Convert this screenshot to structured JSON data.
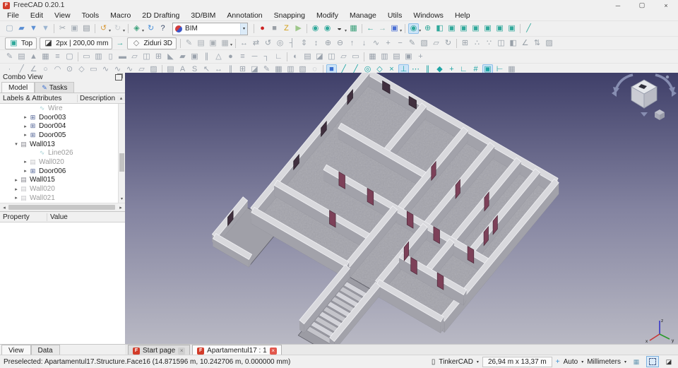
{
  "window": {
    "title": "FreeCAD 0.20.1",
    "logo_glyph": "F",
    "controls": [
      {
        "n": "minimize-icon",
        "g": "─"
      },
      {
        "n": "maximize-icon",
        "g": "▢"
      },
      {
        "n": "close-icon",
        "g": "×"
      }
    ]
  },
  "glyphs": {
    "caret_down": "▾",
    "scroll_up": "▴",
    "scroll_down": "▾",
    "scroll_left": "◂",
    "scroll_right": "▸",
    "expander_collapsed": "▸",
    "expander_expanded": "▾",
    "close": "×",
    "pencil": "✎"
  },
  "menubar": [
    "File",
    "Edit",
    "View",
    "Tools",
    "Macro",
    "2D Drafting",
    "3D/BIM",
    "Annotation",
    "Snapping",
    "Modify",
    "Manage",
    "Utils",
    "Windows",
    "Help"
  ],
  "workbench": {
    "value": "BIM"
  },
  "toolbars": {
    "row1a": [
      {
        "n": "file-new",
        "g": "▢",
        "c": "#9fb0c0"
      },
      {
        "n": "file-open",
        "g": "▰",
        "c": "#5b8fd4"
      },
      {
        "n": "file-save",
        "g": "▼",
        "c": "#5b8fd4"
      },
      {
        "n": "file-save-as",
        "g": "▼",
        "c": "#9ab4d0"
      },
      {
        "n": "cut",
        "g": "✂",
        "c": "#9aa2aa",
        "sep": true
      },
      {
        "n": "copy",
        "g": "▣",
        "c": "#aab2ba"
      },
      {
        "n": "paste",
        "g": "▤",
        "c": "#8a929a"
      },
      {
        "n": "undo",
        "g": "↺",
        "c": "#d79a3c",
        "caret": true,
        "sep": true
      },
      {
        "n": "redo",
        "g": "↻",
        "c": "#c9cdd1",
        "caret": true
      },
      {
        "n": "workbench-tools",
        "g": "◈",
        "c": "#3aa07a",
        "caret": true,
        "sep": true
      },
      {
        "n": "refresh",
        "g": "↻",
        "c": "#4a90d9"
      },
      {
        "n": "whats-this",
        "g": "?",
        "c": "#3a4a6a"
      }
    ],
    "row1b": [
      {
        "n": "macro-record",
        "g": "●",
        "c": "#cc2222",
        "sep": true
      },
      {
        "n": "macro-stop",
        "g": "■",
        "c": "#9aa0a6"
      },
      {
        "n": "macro-edit",
        "g": "Z",
        "c": "#d4a017"
      },
      {
        "n": "macro-execute",
        "g": "▶",
        "c": "#9ec78a"
      },
      {
        "n": "selection-view",
        "g": "◉",
        "c": "#2fa89a",
        "sep": true
      },
      {
        "n": "box-selection",
        "g": "◉",
        "c": "#2fa89a"
      },
      {
        "n": "draw-style",
        "g": "◒",
        "c": "#333333",
        "caret": true
      },
      {
        "n": "texture-mode",
        "g": "▦",
        "c": "#3aa07a"
      },
      {
        "n": "nav-back",
        "g": "←",
        "c": "#2fa89a",
        "sep": true
      },
      {
        "n": "nav-forward",
        "g": "→",
        "c": "#8fb8b2"
      },
      {
        "n": "linked-object-nav",
        "g": "▣",
        "c": "#4a6fd4",
        "caret": true
      },
      {
        "n": "zoom-tool",
        "g": "◉",
        "c": "#2fa89a",
        "caret": true,
        "hl": true,
        "sep": true
      },
      {
        "n": "view-fit-all",
        "g": "⊕",
        "c": "#2fa89a"
      },
      {
        "n": "view-axonometric",
        "g": "◧",
        "c": "#2fa89a"
      },
      {
        "n": "view-front",
        "g": "▣",
        "c": "#2fa89a"
      },
      {
        "n": "view-top",
        "g": "▣",
        "c": "#2fa89a"
      },
      {
        "n": "view-right",
        "g": "▣",
        "c": "#2fa89a"
      },
      {
        "n": "view-rear",
        "g": "▣",
        "c": "#2fa89a"
      },
      {
        "n": "view-bottom",
        "g": "▣",
        "c": "#2fa89a"
      },
      {
        "n": "view-left",
        "g": "▣",
        "c": "#2fa89a"
      },
      {
        "n": "bim-measure",
        "g": "╱",
        "c": "#2fa89a",
        "sep": true
      }
    ],
    "tray": {
      "top_label": "Top",
      "top_icon_glyph": "▣",
      "linewidth_label": "2px | 200,00 mm",
      "linewidth_icon_glyph": "◪",
      "arrow_glyph": "→",
      "layer_label": "Ziduri 3D",
      "layer_icon_glyph": "◇"
    },
    "row2": [
      {
        "n": "draft-apply-style",
        "g": "✎",
        "c": "#a8aeb4",
        "sep": true
      },
      {
        "n": "draft-layer",
        "g": "▤",
        "c": "#a8aeb4"
      },
      {
        "n": "draft-add-to-group",
        "g": "▣",
        "c": "#a8aeb4"
      },
      {
        "n": "draft-select-group",
        "g": "▦",
        "c": "#a8aeb4",
        "caret": true
      },
      {
        "n": "draft-move",
        "g": "↔",
        "c": "#98a0a8",
        "sep": true
      },
      {
        "n": "draft-copy",
        "g": "⇄",
        "c": "#98a0a8"
      },
      {
        "n": "draft-rotate",
        "g": "↺",
        "c": "#98a0a8"
      },
      {
        "n": "draft-offset",
        "g": "◎",
        "c": "#98a0a8"
      },
      {
        "n": "draft-trimex",
        "g": "┤",
        "c": "#98a0a8"
      },
      {
        "n": "draft-scale",
        "g": "⇕",
        "c": "#98a0a8"
      },
      {
        "n": "draft-stretch",
        "g": "↕",
        "c": "#98a0a8"
      },
      {
        "n": "draft-join",
        "g": "⊕",
        "c": "#98a0a8"
      },
      {
        "n": "draft-split",
        "g": "⊖",
        "c": "#98a0a8"
      },
      {
        "n": "draft-upgrade",
        "g": "↑",
        "c": "#98a0a8"
      },
      {
        "n": "draft-downgrade",
        "g": "↓",
        "c": "#98a0a8"
      },
      {
        "n": "draft-wire-to-bspline",
        "g": "∿",
        "c": "#98a0a8"
      },
      {
        "n": "draft-add-point",
        "g": "+",
        "c": "#98a0a8"
      },
      {
        "n": "draft-remove-point",
        "g": "−",
        "c": "#98a0a8"
      },
      {
        "n": "draft-edit",
        "g": "✎",
        "c": "#98a0a8"
      },
      {
        "n": "draft-subelement-highlight",
        "g": "▧",
        "c": "#98a0a8"
      },
      {
        "n": "draft-shape2dview",
        "g": "▱",
        "c": "#98a0a8"
      },
      {
        "n": "draft-to-sketch",
        "g": "↻",
        "c": "#98a0a8"
      },
      {
        "n": "draft-array",
        "g": "⊞",
        "c": "#98a0a8",
        "sep": true
      },
      {
        "n": "draft-path-array",
        "g": "∴",
        "c": "#98a0a8"
      },
      {
        "n": "draft-point-array",
        "g": "∵",
        "c": "#98a0a8"
      },
      {
        "n": "draft-clone",
        "g": "◫",
        "c": "#98a0a8"
      },
      {
        "n": "draft-mirror",
        "g": "◧",
        "c": "#98a0a8"
      },
      {
        "n": "draft-slope",
        "g": "∠",
        "c": "#98a0a8"
      },
      {
        "n": "draft-flip",
        "g": "⇅",
        "c": "#98a0a8"
      },
      {
        "n": "draft-hatch",
        "g": "▨",
        "c": "#98a0a8"
      }
    ],
    "row3": [
      {
        "n": "bim-sketch",
        "g": "✎",
        "c": "#9aa2ac"
      },
      {
        "n": "bim-project",
        "g": "▤",
        "c": "#9aa2ac"
      },
      {
        "n": "bim-site",
        "g": "▲",
        "c": "#9aa2ac"
      },
      {
        "n": "bim-building",
        "g": "▦",
        "c": "#9aa2ac"
      },
      {
        "n": "bim-level",
        "g": "≡",
        "c": "#9aa2ac"
      },
      {
        "n": "bim-space",
        "g": "▢",
        "c": "#9aa2ac"
      },
      {
        "n": "bim-wall",
        "g": "▭",
        "c": "#9aa2ac",
        "sep": true
      },
      {
        "n": "bim-curtain-wall",
        "g": "▥",
        "c": "#9aa2ac"
      },
      {
        "n": "bim-column",
        "g": "▯",
        "c": "#9aa2ac"
      },
      {
        "n": "bim-beam",
        "g": "▬",
        "c": "#9aa2ac"
      },
      {
        "n": "bim-slab",
        "g": "▱",
        "c": "#9aa2ac"
      },
      {
        "n": "bim-door",
        "g": "◫",
        "c": "#9aa2ac"
      },
      {
        "n": "bim-window",
        "g": "⊞",
        "c": "#9aa2ac"
      },
      {
        "n": "bim-roof",
        "g": "◣",
        "c": "#9aa2ac"
      },
      {
        "n": "bim-panel",
        "g": "▰",
        "c": "#9aa2ac"
      },
      {
        "n": "bim-frame",
        "g": "▣",
        "c": "#9aa2ac"
      },
      {
        "n": "bim-fence",
        "g": "∥",
        "c": "#9aa2ac"
      },
      {
        "n": "bim-truss",
        "g": "△",
        "c": "#9aa2ac"
      },
      {
        "n": "bim-equipment",
        "g": "●",
        "c": "#9aa2ac"
      },
      {
        "n": "bim-rebar",
        "g": "≡",
        "c": "#9aa2ac"
      },
      {
        "n": "bim-pipe",
        "g": "─",
        "c": "#9aa2ac"
      },
      {
        "n": "bim-connector",
        "g": "┐",
        "c": "#9aa2ac"
      },
      {
        "n": "bim-stairs",
        "g": "∟",
        "c": "#9aa2ac"
      },
      {
        "n": "bim-material",
        "g": "◐",
        "c": "#9aa2ac",
        "sep": true
      },
      {
        "n": "bim-schedule",
        "g": "▤",
        "c": "#9aa2ac"
      },
      {
        "n": "bim-section-plane",
        "g": "◪",
        "c": "#9aa2ac"
      },
      {
        "n": "bim-elevation",
        "g": "◫",
        "c": "#9aa2ac"
      },
      {
        "n": "bim-drawing-page",
        "g": "▱",
        "c": "#9aa2ac"
      },
      {
        "n": "bim-shape-view",
        "g": "▭",
        "c": "#9aa2ac"
      },
      {
        "n": "bim-ifc-explorer",
        "g": "▦",
        "c": "#9aa2ac",
        "sep": true
      },
      {
        "n": "bim-classification",
        "g": "▥",
        "c": "#9aa2ac"
      },
      {
        "n": "bim-layer-manager",
        "g": "▤",
        "c": "#9aa2ac"
      },
      {
        "n": "bim-group",
        "g": "▣",
        "c": "#9aa2ac"
      },
      {
        "n": "bim-nudge",
        "g": "+",
        "c": "#9aa2ac"
      }
    ],
    "row4": [
      {
        "n": "draft-point",
        "g": "·",
        "c": "#9aa2ac"
      },
      {
        "n": "draft-line",
        "g": "╱",
        "c": "#9aa2ac"
      },
      {
        "n": "draft-polyline",
        "g": "∠",
        "c": "#9aa2ac"
      },
      {
        "n": "draft-circle",
        "g": "○",
        "c": "#9aa2ac"
      },
      {
        "n": "draft-arc",
        "g": "◠",
        "c": "#9aa2ac"
      },
      {
        "n": "draft-ellipse",
        "g": "⊙",
        "c": "#9aa2ac"
      },
      {
        "n": "draft-polygon",
        "g": "◇",
        "c": "#9aa2ac"
      },
      {
        "n": "draft-rectangle",
        "g": "▭",
        "c": "#9aa2ac"
      },
      {
        "n": "draft-bspline",
        "g": "∿",
        "c": "#9aa2ac"
      },
      {
        "n": "draft-bezier",
        "g": "∿",
        "c": "#9aa2ac"
      },
      {
        "n": "draft-cubic-bezier",
        "g": "∿",
        "c": "#9aa2ac"
      },
      {
        "n": "draft-facebinder",
        "g": "▱",
        "c": "#9aa2ac"
      },
      {
        "n": "draft-hatch2",
        "g": "▨",
        "c": "#9aa2ac"
      },
      {
        "n": "annotation-image",
        "g": "▤",
        "c": "#9aa2ac",
        "sep": true
      },
      {
        "n": "annotation-text",
        "g": "A",
        "c": "#9aa2ac"
      },
      {
        "n": "annotation-shapestring",
        "g": "S",
        "c": "#9aa2ac"
      },
      {
        "n": "annotation-leader",
        "g": "↖",
        "c": "#9aa2ac"
      },
      {
        "n": "annotation-dimension",
        "g": "↔",
        "c": "#9aa2ac"
      },
      {
        "n": "annotation-axis",
        "g": "∥",
        "c": "#9aa2ac"
      },
      {
        "n": "annotation-axis-system",
        "g": "⊞",
        "c": "#9aa2ac"
      },
      {
        "n": "annotation-section-plane",
        "g": "◪",
        "c": "#9aa2ac"
      },
      {
        "n": "annotation-label",
        "g": "✎",
        "c": "#9aa2ac"
      },
      {
        "n": "annotation-grid",
        "g": "▦",
        "c": "#9aa2ac"
      },
      {
        "n": "annotation-page",
        "g": "▥",
        "c": "#9aa2ac"
      },
      {
        "n": "annotation-view",
        "g": "▧",
        "c": "#9aa2ac"
      },
      {
        "n": "annotation-proxy",
        "g": "◌",
        "c": "#9aa2ac"
      },
      {
        "n": "snap-lock",
        "g": "■",
        "c": "#3a6fd0",
        "hl": true,
        "sep": true
      },
      {
        "n": "snap-endpoint",
        "g": "╱",
        "c": "#1fa5a5"
      },
      {
        "n": "snap-midpoint",
        "g": "╱",
        "c": "#1fa5a5"
      },
      {
        "n": "snap-center",
        "g": "◎",
        "c": "#1fa5a5"
      },
      {
        "n": "snap-angle",
        "g": "◇",
        "c": "#1fa5a5"
      },
      {
        "n": "snap-intersection",
        "g": "×",
        "c": "#1fa5a5"
      },
      {
        "n": "snap-perpendicular",
        "g": "⊥",
        "c": "#1fa5a5",
        "hl": true
      },
      {
        "n": "snap-extension",
        "g": "⋯",
        "c": "#1fa5a5"
      },
      {
        "n": "snap-parallel",
        "g": "∥",
        "c": "#1fa5a5"
      },
      {
        "n": "snap-special",
        "g": "◆",
        "c": "#1fa5a5"
      },
      {
        "n": "snap-near",
        "g": "+",
        "c": "#1fa5a5"
      },
      {
        "n": "snap-ortho",
        "g": "∟",
        "c": "#1fa5a5"
      },
      {
        "n": "snap-grid",
        "g": "#",
        "c": "#1fa5a5"
      },
      {
        "n": "snap-working-plane",
        "g": "▣",
        "c": "#1fa5a5",
        "hl": true
      },
      {
        "n": "snap-dimensions",
        "g": "⊢",
        "c": "#1fa5a5"
      },
      {
        "n": "toggle-grid",
        "g": "▦",
        "c": "#9aa2ac"
      }
    ]
  },
  "combo_view": {
    "title": "Combo View",
    "tabs": [
      {
        "label": "Model",
        "active": true
      },
      {
        "label": "Tasks",
        "active": false,
        "icon_glyph": "✎"
      }
    ],
    "tree_header": {
      "col1": "Labels & Attributes",
      "col2": "Description"
    },
    "icons": {
      "wire-icon": {
        "g": "∿",
        "c": "#4aa0a8"
      },
      "door-icon": {
        "g": "⊞",
        "c": "#46598e"
      },
      "wall-icon": {
        "g": "▤",
        "c": "#8a8a92"
      }
    },
    "tree": [
      {
        "label": "Wire",
        "icon": "wire-icon",
        "indent": 3,
        "gray": true,
        "expander": ""
      },
      {
        "label": "Door003",
        "icon": "door-icon",
        "indent": 2,
        "expander": "collapsed"
      },
      {
        "label": "Door004",
        "icon": "door-icon",
        "indent": 2,
        "expander": "collapsed"
      },
      {
        "label": "Door005",
        "icon": "door-icon",
        "indent": 2,
        "expander": "collapsed"
      },
      {
        "label": "Wall013",
        "icon": "wall-icon",
        "indent": 1,
        "expander": "expanded"
      },
      {
        "label": "Line026",
        "icon": "wire-icon",
        "indent": 3,
        "gray": true,
        "expander": ""
      },
      {
        "label": "Wall020",
        "icon": "wall-icon",
        "indent": 2,
        "gray": true,
        "expander": "collapsed"
      },
      {
        "label": "Door006",
        "icon": "door-icon",
        "indent": 2,
        "expander": "collapsed"
      },
      {
        "label": "Wall015",
        "icon": "wall-icon",
        "indent": 1,
        "expander": "collapsed"
      },
      {
        "label": "Wall020",
        "icon": "wall-icon",
        "indent": 1,
        "gray": true,
        "expander": "collapsed"
      },
      {
        "label": "Wall021",
        "icon": "wall-icon",
        "indent": 1,
        "gray": true,
        "expander": "collapsed"
      }
    ],
    "property_header": {
      "col1": "Property",
      "col2": "Value"
    },
    "bottom_tabs": [
      {
        "label": "View",
        "active": true
      },
      {
        "label": "Data",
        "active": false
      }
    ]
  },
  "mdi_tabs": [
    {
      "label": "Start page",
      "active": false,
      "close_style": "gray"
    },
    {
      "label": "Apartamentul17 : 1",
      "active": true,
      "close_style": "red"
    }
  ],
  "statusbar": {
    "message": "Preselected: Apartamentul17.Structure.Face16 (14.871596 m, 10.242706 m, 0.000000 mm)",
    "right_items": [
      {
        "t": "icon",
        "n": "touchscreen-icon",
        "g": "▯",
        "c": "#333333"
      },
      {
        "t": "label",
        "n": "nav-style-label",
        "s": "TinkerCAD"
      },
      {
        "t": "icon",
        "n": "caret-down-icon",
        "g": "▾",
        "c": "#333333"
      },
      {
        "t": "box",
        "n": "model-dimensions",
        "s": "26,94 m x 13,37 m"
      },
      {
        "t": "icon",
        "n": "nudge-icon",
        "g": "+",
        "c": "#3a8fd0"
      },
      {
        "t": "label",
        "n": "nudge-mode-label",
        "s": "Auto"
      },
      {
        "t": "icon",
        "n": "caret-down-icon",
        "g": "▾",
        "c": "#333333"
      },
      {
        "t": "label",
        "n": "units-label",
        "s": "Millimeters"
      },
      {
        "t": "icon",
        "n": "caret-down-icon",
        "g": "▾",
        "c": "#333333"
      },
      {
        "t": "btn",
        "n": "render-quality-button",
        "g": "▦",
        "c": "#6a9ab4"
      },
      {
        "t": "btn",
        "n": "selection-rectangle-button",
        "g": "",
        "c": "",
        "sel": true,
        "dashed": true
      },
      {
        "t": "btn",
        "n": "high-contrast-button",
        "g": "◪",
        "c": "#333333"
      }
    ]
  },
  "viewport": {
    "axis_labels": {
      "x": "x",
      "y": "y",
      "z": "z"
    },
    "colors": {
      "background_top": "#3f3f69",
      "background_bottom": "#b9b9c4",
      "floor": "#a4a4ac",
      "wall_top": "#d9d9dd",
      "wall_side": "#a2a2aa",
      "door": "#7d4159"
    }
  }
}
